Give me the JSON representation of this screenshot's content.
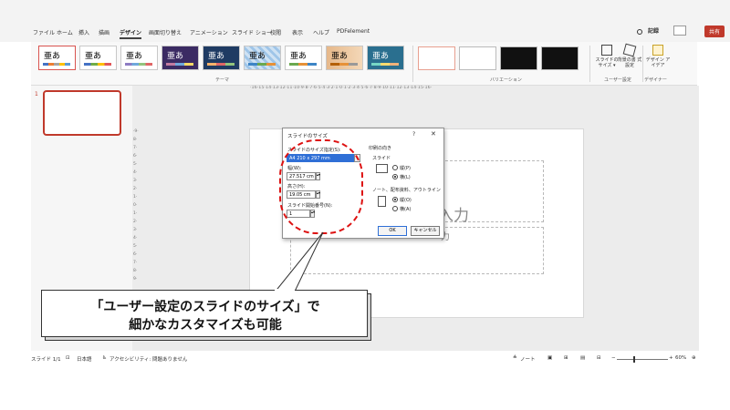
{
  "tabs": [
    "ファイル",
    "ホーム",
    "挿入",
    "描画",
    "デザイン",
    "画面切り替え",
    "アニメーション",
    "スライド ショー",
    "校閲",
    "表示",
    "ヘルプ",
    "PDFelement"
  ],
  "active_tab": "デザイン",
  "top_right": {
    "record_label": "記録",
    "share_label": "共有"
  },
  "ribbon": {
    "theme_sample": "亜あ",
    "themes_group_label": "テーマ",
    "variants_group_label": "バリエーション",
    "slide_size_label": "スライドの サイズ ▾",
    "background_format_label": "背景の書 式設定",
    "custom_group_label": "ユーザー設定",
    "design_ideas_label": "デザイン アイデア",
    "designer_group_label": "デザイナー"
  },
  "ruler_h": "·16·15·14·13·12·11·10·9·8·7·6·5·4·3·2·1·0·1·2·3·4·5·6·7·8·9·10·11·12·13·14·15·16·",
  "ruler_v": "·9·8·7·6·5·4·3·2·1·0·1·2·3·4·5·6·7·8·9·",
  "thumbnail_number": "1",
  "slide": {
    "title_placeholder": "入力",
    "subtitle_placeholder": "力"
  },
  "dialog": {
    "title": "スライドのサイズ",
    "help": "?",
    "close": "✕",
    "size_label": "スライドのサイズ指定(S):",
    "size_value": "A4 210 x 297 mm",
    "width_label": "幅(W):",
    "width_value": "27.517 cm",
    "height_label": "高さ(H):",
    "height_value": "19.05 cm",
    "start_label": "スライド開始番号(N):",
    "start_value": "1",
    "orientation_label": "印刷の向き",
    "slide_section": "スライド",
    "portrait": "縦(P)",
    "landscape": "横(L)",
    "notes_section": "ノート、配布資料、アウトライン",
    "notes_portrait": "縦(O)",
    "notes_landscape": "横(A)",
    "ok": "OK",
    "cancel": "キャンセル"
  },
  "callout": {
    "line1": "「ユーザー設定のスライドのサイズ」で",
    "line2": "細かなカスタマイズも可能"
  },
  "status": {
    "slide_count": "スライド 1/1",
    "language": "日本語",
    "accessibility": "アクセシビリティ: 問題ありません",
    "notes": "ノート",
    "zoom": "60%"
  }
}
